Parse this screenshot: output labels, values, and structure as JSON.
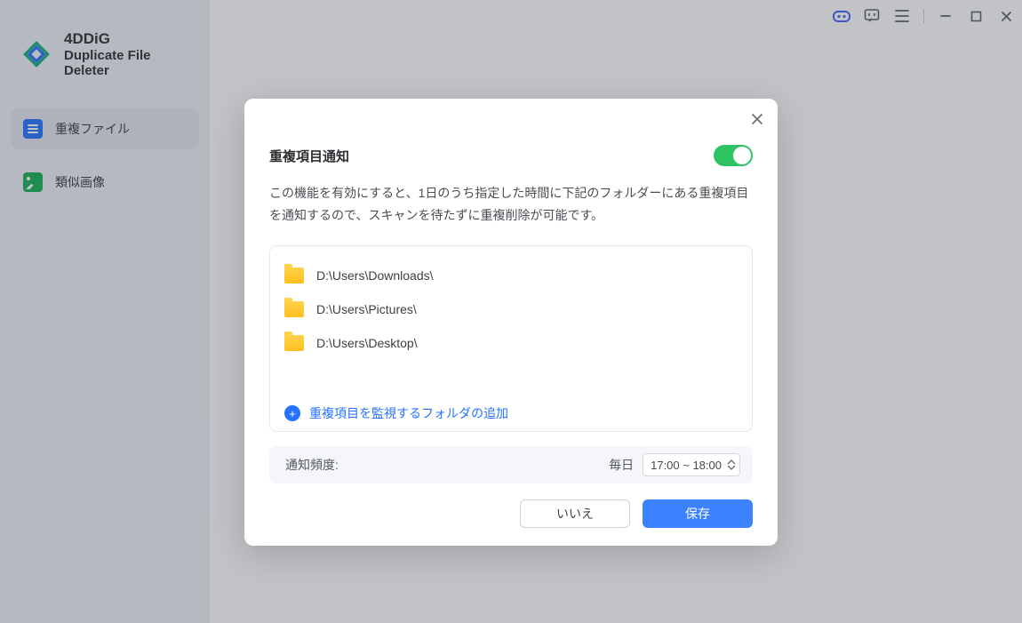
{
  "brand": {
    "line1": "4DDiG",
    "line2": "Duplicate File Deleter"
  },
  "nav": {
    "items": [
      {
        "label": "重複ファイル",
        "active": true
      },
      {
        "label": "類似画像",
        "active": false
      }
    ]
  },
  "modal": {
    "title": "重複項目通知",
    "toggle_on": true,
    "description": "この機能を有効にすると、1日のうち指定した時間に下記のフォルダーにある重複項目を通知するので、スキャンを待たずに重複削除が可能です。",
    "folders": [
      "D:\\Users\\Downloads\\",
      "D:\\Users\\Pictures\\",
      "D:\\Users\\Desktop\\"
    ],
    "add_folder_label": "重複項目を監視するフォルダの追加",
    "freq_label": "通知頻度:",
    "freq_prefix": "毎日",
    "freq_time": "17:00 ~ 18:00",
    "btn_no": "いいえ",
    "btn_save": "保存"
  }
}
